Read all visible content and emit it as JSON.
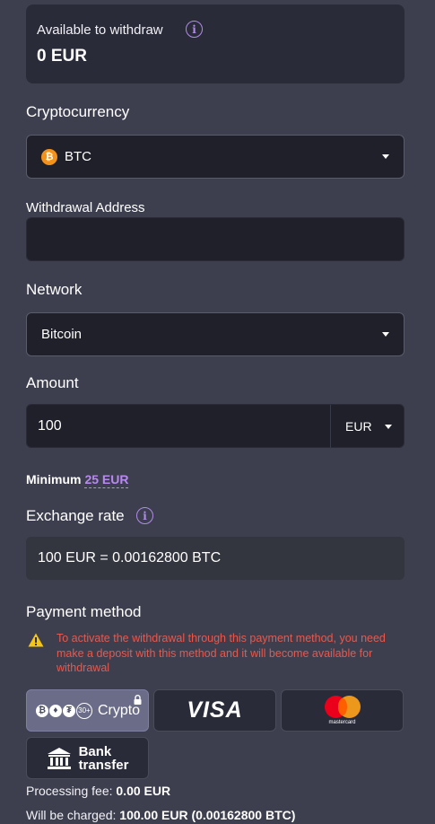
{
  "balance": {
    "label": "Available to withdraw",
    "value": "0 EUR",
    "info_icon": "info-icon"
  },
  "crypto": {
    "label": "Cryptocurrency",
    "selected": "BTC",
    "coin_symbol": "₿"
  },
  "address": {
    "label": "Withdrawal Address",
    "value": ""
  },
  "network": {
    "label": "Network",
    "selected": "Bitcoin"
  },
  "amount": {
    "label": "Amount",
    "value": "100",
    "currency": "EUR"
  },
  "minimum": {
    "label": "Minimum",
    "value": "25 EUR"
  },
  "exchange": {
    "label": "Exchange rate",
    "value": "100 EUR = 0.00162800 BTC"
  },
  "payment": {
    "label": "Payment method",
    "warning": "To activate the withdrawal through this payment method, you need make a deposit with this method and it will become available for withdrawal",
    "crypto_label": "Crypto",
    "crypto_more": "30+",
    "visa_label": "VISA",
    "mastercard_label": "mastercard",
    "bank_line1": "Bank",
    "bank_line2": "transfer"
  },
  "summary": {
    "fee_label": "Processing fee:",
    "fee_value": "0.00 EUR",
    "charged_label": "Will be charged:",
    "charged_value": "100.00 EUR (0.00162800 BTC)"
  },
  "colors": {
    "background": "#3d3f4f",
    "accent": "#b889f0",
    "warning": "#e5594f"
  }
}
